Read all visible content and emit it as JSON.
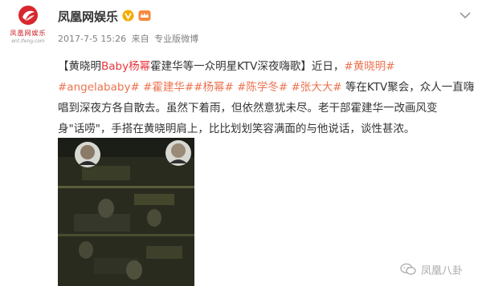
{
  "header": {
    "user_name": "凤凰网娱乐",
    "avatar_name": "凤凰网娱乐",
    "avatar_url": "ent.ifeng.com",
    "verified_icon": "verified-v-icon",
    "vip_icon": "vip-crown-icon",
    "menu_icon": "chevron-down-icon",
    "date": "2017-7-5 15:26",
    "source_prefix": "来自",
    "source": "专业版微博"
  },
  "post": {
    "line1": {
      "bracket_open": "【黄晓明",
      "highlight": "Baby杨幂",
      "title_rest": "霍建华等一众明星KTV深夜嗨歌】",
      "text": "近日，",
      "topic": "#黄晓明#"
    },
    "line2": {
      "topics": "#angelababy# #霍建华##杨幂# #陈学冬# #张大大#",
      "text": " 等在KTV聚会，众人一直嗨"
    },
    "line3": "唱到深夜方各自散去。虽然下着雨，但依然意犹未尽。老干部霍建华一改画风变",
    "line4": "身\"话唠\"，手搭在黄晓明肩上，比比划划笑容满面的与他说话，谈性甚浓。"
  },
  "watermark": {
    "icon": "wechat-icon",
    "text": "凤凰八卦"
  },
  "colors": {
    "accent_red": "#e8373e",
    "topic_orange": "#eb7350",
    "verified_yellow": "#f6ab00"
  }
}
